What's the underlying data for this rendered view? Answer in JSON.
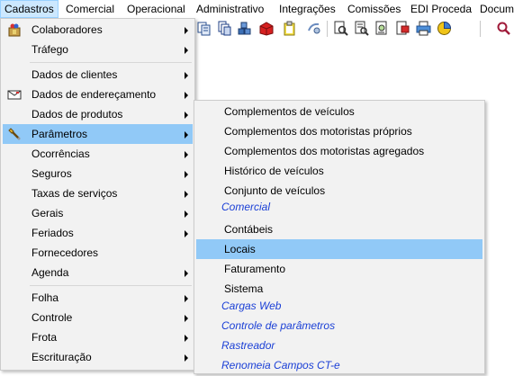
{
  "menubar": {
    "items": [
      {
        "label": "Cadastros"
      },
      {
        "label": "Comercial"
      },
      {
        "label": "Operacional"
      },
      {
        "label": "Administrativo"
      },
      {
        "label": "Integrações"
      },
      {
        "label": "Comissões"
      },
      {
        "label": "EDI Proceda"
      },
      {
        "label": "Docum"
      }
    ]
  },
  "toolbar": {
    "icons": [
      "document-copy-icon",
      "documents-icon",
      "blocks-icon",
      "red-box-icon",
      "clipboard-icon",
      "gear-script-icon",
      "preview-icon",
      "report-icon",
      "settings-doc-icon",
      "exit-icon",
      "printer-icon",
      "pie-chart-icon",
      "search-icon"
    ]
  },
  "cadastros_menu": {
    "items": [
      {
        "label": "Colaboradores",
        "has_submenu": true,
        "icon": "colaboradores-icon"
      },
      {
        "label": "Tráfego",
        "has_submenu": true
      },
      {
        "label": "Dados de clientes",
        "has_submenu": true
      },
      {
        "label": "Dados de endereçamento",
        "has_submenu": true,
        "icon": "envelope-icon"
      },
      {
        "label": "Dados de produtos",
        "has_submenu": true
      },
      {
        "label": "Parâmetros",
        "has_submenu": true,
        "icon": "wrench-icon",
        "highlighted": true
      },
      {
        "label": "Ocorrências",
        "has_submenu": true
      },
      {
        "label": "Seguros",
        "has_submenu": true
      },
      {
        "label": "Taxas de serviços",
        "has_submenu": true
      },
      {
        "label": "Gerais",
        "has_submenu": true
      },
      {
        "label": "Feriados",
        "has_submenu": true
      },
      {
        "label": "Fornecedores",
        "has_submenu": false
      },
      {
        "label": "Agenda",
        "has_submenu": true
      },
      {
        "label": "Folha",
        "has_submenu": true
      },
      {
        "label": "Controle",
        "has_submenu": true
      },
      {
        "label": "Frota",
        "has_submenu": true
      },
      {
        "label": "Escrituração",
        "has_submenu": true
      }
    ]
  },
  "parametros_submenu": {
    "items": [
      {
        "label": "Complementos de veículos",
        "style": "normal"
      },
      {
        "label": "Complementos dos motoristas próprios",
        "style": "normal"
      },
      {
        "label": "Complementos dos motoristas agregados",
        "style": "normal"
      },
      {
        "label": "Histórico de veículos",
        "style": "normal"
      },
      {
        "label": "Conjunto de veículos",
        "style": "normal"
      },
      {
        "label": "Comercial",
        "style": "link"
      },
      {
        "label": "Contábeis",
        "style": "normal"
      },
      {
        "label": "Locais",
        "style": "normal",
        "highlighted": true
      },
      {
        "label": "Faturamento",
        "style": "normal"
      },
      {
        "label": "Sistema",
        "style": "normal"
      },
      {
        "label": "Cargas Web",
        "style": "link"
      },
      {
        "label": "Controle de parâmetros",
        "style": "link"
      },
      {
        "label": "Rastreador",
        "style": "link"
      },
      {
        "label": "Renomeia Campos CT-e",
        "style": "link"
      }
    ]
  },
  "colors": {
    "menu_bg": "#f2f2f2",
    "highlight": "#91c9f7",
    "menubar_active": "#cce8ff",
    "link_text": "#1a3fd6"
  }
}
